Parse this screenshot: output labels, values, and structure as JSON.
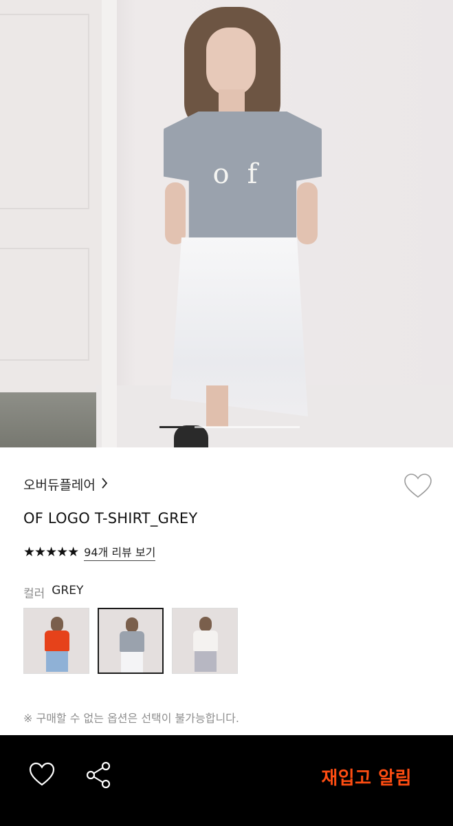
{
  "hero": {
    "image": "model wearing grey OF logo t-shirt and white skirt",
    "tee_logo": "of",
    "slide_progress": 0.25
  },
  "product": {
    "brand": "오버듀플레어",
    "brand_chevron": "›",
    "name": "OF LOGO T-SHIRT_GREY",
    "rating_stars": 5,
    "stars_display": "★★★★★",
    "review_link": "94개 리뷰 보기",
    "color_label": "컬러",
    "color_value": "GREY",
    "color_options": [
      {
        "name": "orange",
        "top": "#e6421a",
        "bottom": "#8fb1d6",
        "selected": false
      },
      {
        "name": "grey",
        "top": "#9aa2ad",
        "bottom": "#f4f4f6",
        "selected": true
      },
      {
        "name": "white",
        "top": "#f4f2f0",
        "bottom": "#b7b7c2",
        "selected": false
      }
    ],
    "notice": "※ 구매할 수 없는 옵션은 선택이 불가능합니다."
  },
  "bottom_bar": {
    "restock_label": "재입고 알림"
  },
  "colors": {
    "accent": "#ff4d12",
    "bar_bg": "#000000"
  },
  "icons": [
    "heart-outline-icon",
    "share-icon",
    "chevron-right-icon",
    "star-icon"
  ]
}
